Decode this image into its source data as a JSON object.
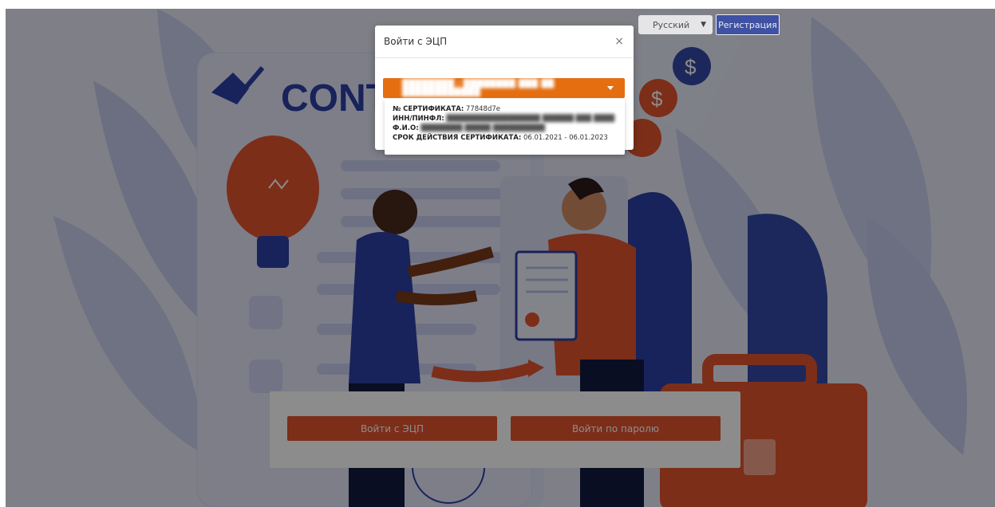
{
  "header": {
    "language": "Русский",
    "register_label": "Регистрация",
    "brand_text": "CONT"
  },
  "icons": {
    "language_chevron": "chevron-down-icon",
    "dropdown_caret": "caret-down-icon",
    "close": "close-icon"
  },
  "modal": {
    "title": "Войти с ЭЦП",
    "close_symbol": "×",
    "selected_certificate": "████████ / ████████ ███ ██ ████████████",
    "details": {
      "cert_no_label": "№ СЕРТИФИКАТА:",
      "cert_no_value": "77848d7e",
      "inn_label": "ИНН/ПИНФЛ:",
      "inn_value": "██████████████████ ██████ ███ ████",
      "fio_label": "Ф.И.О:",
      "fio_value": "████████ █████ ██████████",
      "validity_label": "СРОК ДЕЙСТВИЯ СЕРТИФИКАТА:",
      "validity_value": "06.01.2021 - 06.01.2023"
    }
  },
  "login": {
    "ecp_button": "Войти с ЭЦП",
    "password_button": "Войти по паролю"
  },
  "colors": {
    "accent_orange": "#e46e10",
    "button_red": "#e2542f",
    "register_blue": "#3349a8"
  }
}
